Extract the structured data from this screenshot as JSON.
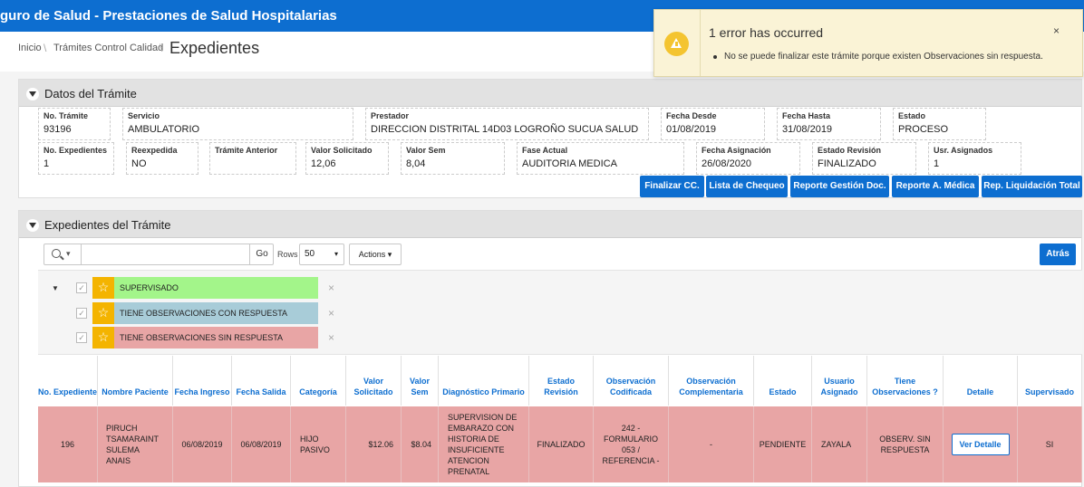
{
  "app": {
    "title": "guro de Salud - Prestaciones de Salud Hospitalarias"
  },
  "breadcrumb": {
    "items": [
      "Inicio",
      "Trámites Control Calidad"
    ],
    "current": "Expedientes"
  },
  "notification": {
    "title": "1 error has occurred",
    "message": "No se puede finalizar este trámite porque existen Observaciones sin respuesta.",
    "close": "×"
  },
  "tramite": {
    "section_title": "Datos del Trámite",
    "fields": [
      {
        "label": "No. Trámite",
        "value": "93196"
      },
      {
        "label": "Servicio",
        "value": "AMBULATORIO"
      },
      {
        "label": "Prestador",
        "value": "DIRECCION DISTRITAL 14D03 LOGROÑO SUCUA SALUD"
      },
      {
        "label": "Fecha Desde",
        "value": "01/08/2019"
      },
      {
        "label": "Fecha Hasta",
        "value": "31/08/2019"
      },
      {
        "label": "Estado",
        "value": "PROCESO"
      },
      {
        "label": "No. Expedientes",
        "value": "1"
      },
      {
        "label": "Reexpedida",
        "value": "NO"
      },
      {
        "label": "Trámite Anterior",
        "value": ""
      },
      {
        "label": "Valor Solicitado",
        "value": "12,06"
      },
      {
        "label": "Valor Sem",
        "value": "8,04"
      },
      {
        "label": "Fase Actual",
        "value": "AUDITORIA MEDICA"
      },
      {
        "label": "Fecha Asignación",
        "value": "26/08/2020"
      },
      {
        "label": "Estado Revisión",
        "value": "FINALIZADO"
      },
      {
        "label": "Usr. Asignados",
        "value": "1"
      }
    ],
    "buttons": [
      "Finalizar CC.",
      "Lista de Chequeo",
      "Reporte Gestión Doc.",
      "Reporte A. Médica",
      "Rep. Liquidación Total"
    ]
  },
  "expedientes": {
    "section_title": "Expedientes del Trámite",
    "toolbar": {
      "search_value": "",
      "go": "Go",
      "rows_label": "Rows",
      "rows_value": "50",
      "actions": "Actions",
      "back": "Atrás"
    },
    "highlights": [
      {
        "label": "SUPERVISADO",
        "color": "#a3f58a"
      },
      {
        "label": "TIENE OBSERVACIONES CON RESPUESTA",
        "color": "#a8ccd8"
      },
      {
        "label": "TIENE OBSERVACIONES SIN RESPUESTA",
        "color": "#e8a5a5"
      }
    ],
    "columns": [
      "No. Expediente",
      "Nombre Paciente",
      "Fecha Ingreso",
      "Fecha Salida",
      "Categoría",
      "Valor Solicitado",
      "Valor Sem",
      "Diagnóstico Primario",
      "Estado Revisión",
      "Observación Codificada",
      "Observación Complementaria",
      "Estado",
      "Usuario Asignado",
      "Tiene Observaciones ?",
      "Detalle",
      "Supervisado"
    ],
    "rows": [
      [
        "196",
        "PIRUCH TSAMARAINT SULEMA ANAIS",
        "06/08/2019",
        "06/08/2019",
        "HIJO PASIVO",
        "$12.06",
        "$8.04",
        "SUPERVISION DE EMBARAZO CON HISTORIA DE INSUFICIENTE ATENCION PRENATAL",
        "FINALIZADO",
        "242 - FORMULARIO 053 / REFERENCIA -",
        "-",
        "PENDIENTE",
        "ZAYALA",
        "OBSERV. SIN RESPUESTA",
        "Ver Detalle",
        "SI"
      ]
    ]
  }
}
